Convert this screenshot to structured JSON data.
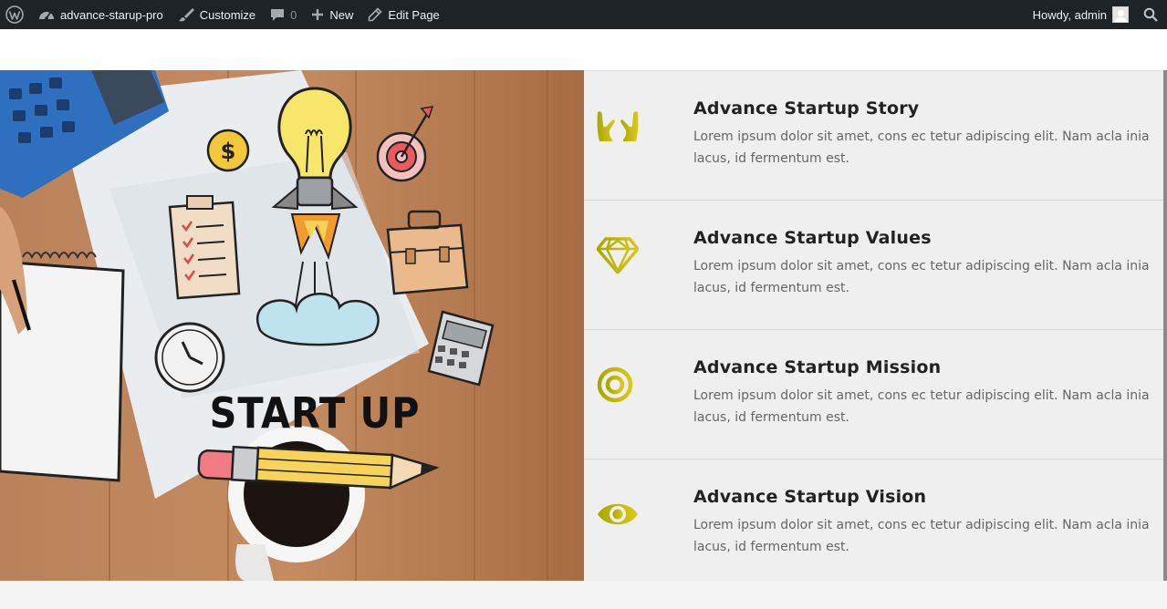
{
  "adminbar": {
    "site_name": "advance-starup-pro",
    "customize": "Customize",
    "comments_count": "0",
    "new": "New",
    "edit_page": "Edit Page",
    "howdy": "Howdy, admin"
  },
  "hero": {
    "image_text": "START UP"
  },
  "features": [
    {
      "icon": "hands-icon",
      "title": "Advance Startup Story",
      "text": "Lorem ipsum dolor sit amet, cons ec tetur adipiscing elit. Nam acla inia lacus, id fermentum est."
    },
    {
      "icon": "diamond-icon",
      "title": "Advance Startup Values",
      "text": "Lorem ipsum dolor sit amet, cons ec tetur adipiscing elit. Nam acla inia lacus, id fermentum est."
    },
    {
      "icon": "target-icon",
      "title": "Advance Startup Mission",
      "text": "Lorem ipsum dolor sit amet, cons ec tetur adipiscing elit. Nam acla inia lacus, id fermentum est."
    },
    {
      "icon": "eye-icon",
      "title": "Advance Startup Vision",
      "text": "Lorem ipsum dolor sit amet, cons ec tetur adipiscing elit. Nam acla inia lacus, id fermentum est."
    }
  ],
  "colors": {
    "adminbar_bg": "#1d2327",
    "icon_gradient_start": "#a8a800",
    "icon_gradient_end": "#d6c515",
    "panel_bg": "#efefef"
  }
}
